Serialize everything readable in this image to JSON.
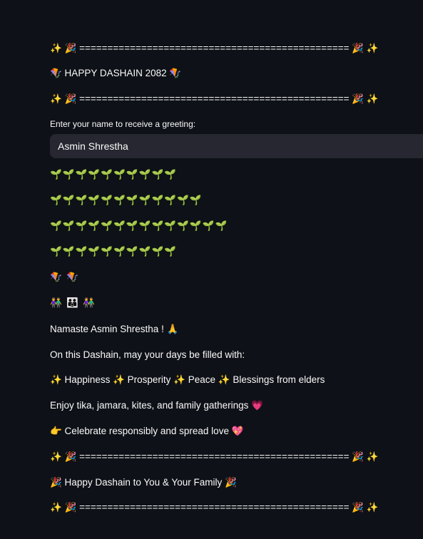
{
  "lines": {
    "top_divider": "✨ 🎉 ================================================ 🎉 ✨",
    "title": "🪁 HAPPY DASHAIN 2082 🪁",
    "second_divider": "✨ 🎉 ================================================ 🎉 ✨",
    "sprouts_1": "🌱🌱🌱🌱🌱🌱🌱🌱🌱🌱",
    "sprouts_2": "🌱🌱🌱🌱🌱🌱🌱🌱🌱🌱🌱🌱",
    "sprouts_3": "🌱🌱🌱🌱🌱🌱🌱🌱🌱🌱🌱🌱🌱🌱",
    "sprouts_4": "🌱🌱🌱🌱🌱🌱🌱🌱🌱🌱",
    "kites": "🪁 🪁",
    "family": "👫 👪 👫",
    "namaste": "Namaste Asmin Shrestha ! 🙏",
    "wish_intro": "On this Dashain, may your days be filled with:",
    "blessings": "✨ Happiness ✨ Prosperity ✨ Peace ✨ Blessings from elders",
    "enjoy": "Enjoy tika, jamara, kites, and family gatherings 💗",
    "celebrate": "👉 Celebrate responsibly and spread love 💖",
    "bottom_divider_1": "✨ 🎉 ================================================ 🎉 ✨",
    "closing": "🎉 Happy Dashain to You & Your Family 🎉",
    "bottom_divider_2": "✨ 🎉 ================================================ 🎉 ✨"
  },
  "name_field": {
    "label": "Enter your name to receive a greeting:",
    "value": "Asmin Shrestha"
  }
}
